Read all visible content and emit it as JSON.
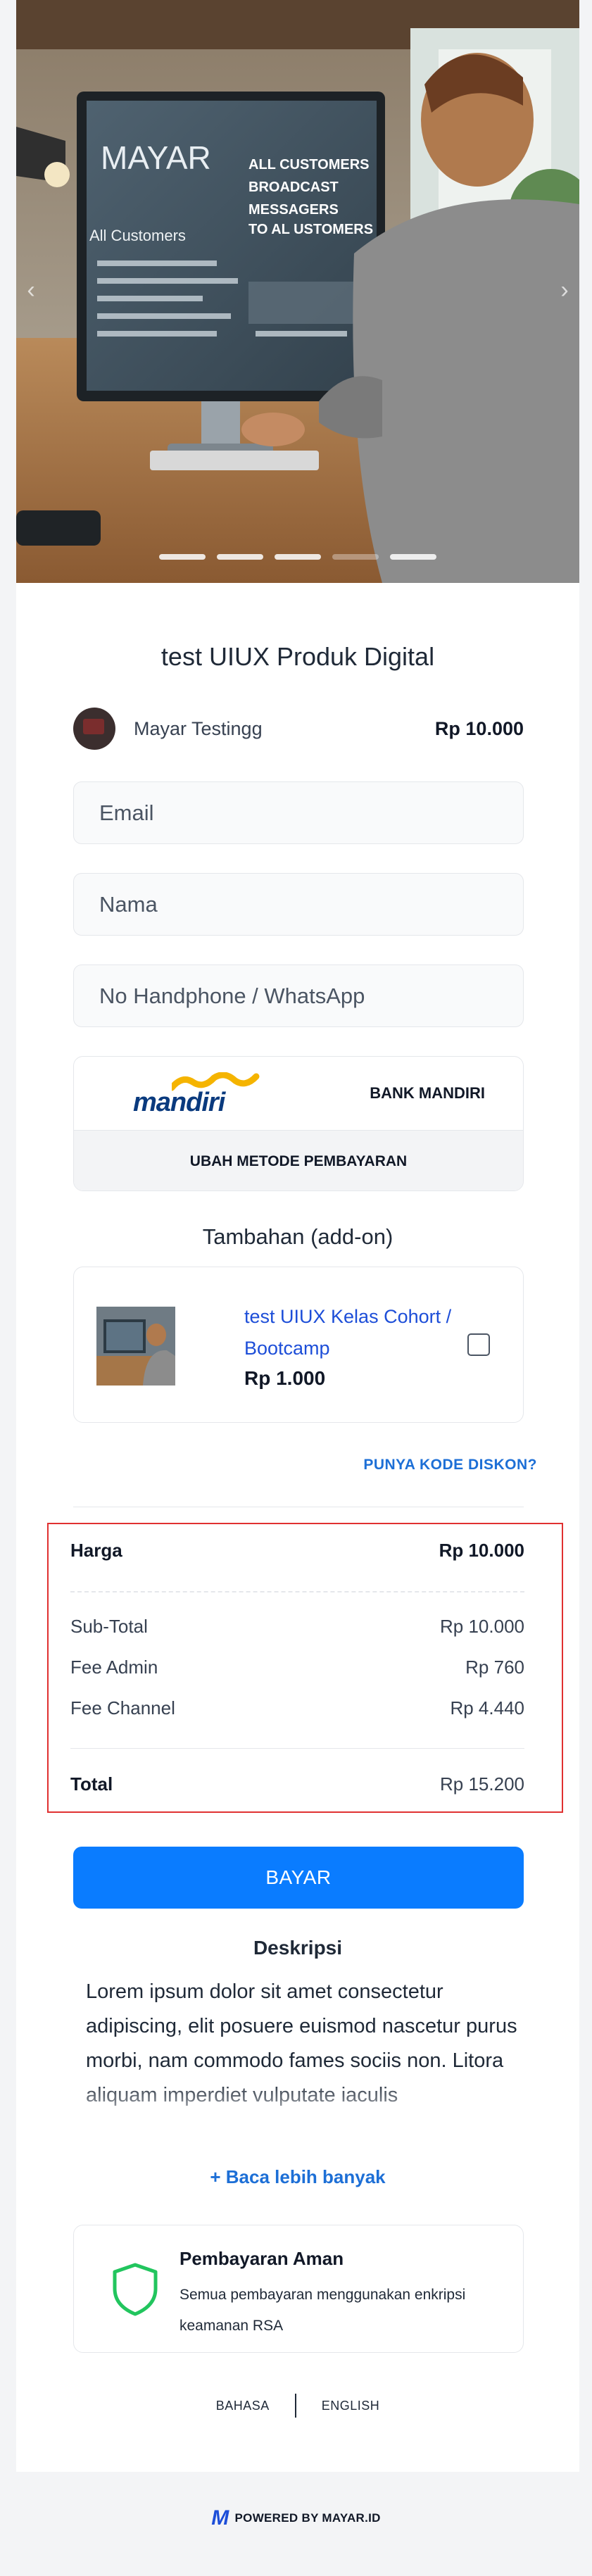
{
  "hero": {
    "screen_brand": "MAYAR",
    "screen_headline": "ALL CUSTOMERS BROADCAST MESSAGERS TO AL USTOMERS",
    "screen_subtitle": "All Customers",
    "slide_count": 5,
    "active_slide": 4
  },
  "product": {
    "title": "test UIUX Produk Digital",
    "seller_name": "Mayar Testingg",
    "price": "Rp 10.000"
  },
  "form": {
    "email_placeholder": "Email",
    "name_placeholder": "Nama",
    "phone_placeholder": "No Handphone / WhatsApp"
  },
  "payment": {
    "bank_logo_text": "mandiri",
    "bank_name": "BANK MANDIRI",
    "change_label": "UBAH METODE PEMBAYARAN"
  },
  "addon": {
    "heading": "Tambahan (add-on)",
    "title": "test UIUX Kelas Cohort / Bootcamp",
    "price": "Rp 1.000",
    "checked": false
  },
  "discount_label": "PUNYA KODE DISKON?",
  "summary": {
    "harga_label": "Harga",
    "harga_value": "Rp 10.000",
    "subtotal_label": "Sub-Total",
    "subtotal_value": "Rp 10.000",
    "fee_admin_label": "Fee Admin",
    "fee_admin_value": "Rp 760",
    "fee_channel_label": "Fee Channel",
    "fee_channel_value": "Rp 4.440",
    "total_label": "Total",
    "total_value": "Rp 15.200"
  },
  "pay_label": "BAYAR",
  "description": {
    "heading": "Deskripsi",
    "text": "Lorem ipsum dolor sit amet consectetur adipiscing, elit posuere euismod nascetur purus morbi, nam commodo fames sociis non. Litora aliquam imperdiet vulputate iaculis",
    "more_label": "+ Baca lebih banyak"
  },
  "secure": {
    "title": "Pembayaran Aman",
    "text": "Semua pembayaran menggunakan enkripsi keamanan RSA"
  },
  "language": {
    "label": "BAHASA",
    "value": "ENGLISH"
  },
  "footer": {
    "logo_letter": "M",
    "powered": "POWERED BY MAYAR.ID"
  },
  "colors": {
    "accent": "#0a7cff",
    "link": "#1d6fd6",
    "highlight_border": "#e03131",
    "secure_icon": "#22c55e"
  }
}
